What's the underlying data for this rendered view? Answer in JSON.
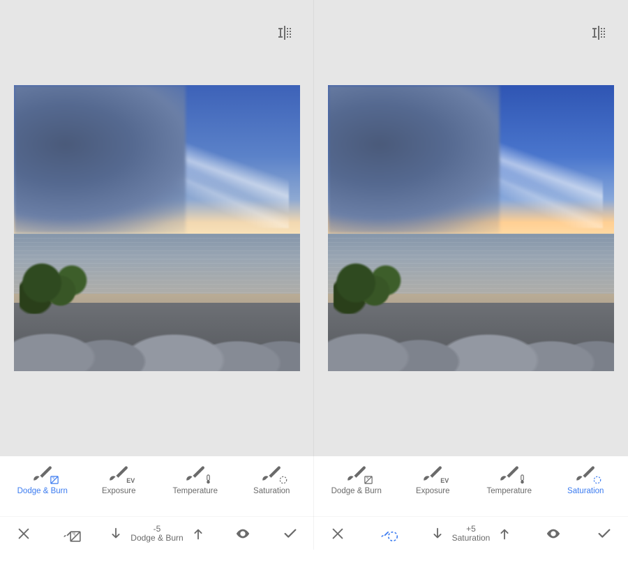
{
  "panels": [
    {
      "activeTool": "dodgeBurn",
      "stepper": {
        "value": "-5",
        "label": "Dodge & Burn"
      },
      "brushIconActive": false
    },
    {
      "activeTool": "saturation",
      "stepper": {
        "value": "+5",
        "label": "Saturation"
      },
      "brushIconActive": true
    }
  ],
  "tools": {
    "dodgeBurn": {
      "label": "Dodge & Burn",
      "badge": "db"
    },
    "exposure": {
      "label": "Exposure",
      "badge": "EV"
    },
    "temperature": {
      "label": "Temperature",
      "badge": "th"
    },
    "saturation": {
      "label": "Saturation",
      "badge": "sa"
    }
  }
}
